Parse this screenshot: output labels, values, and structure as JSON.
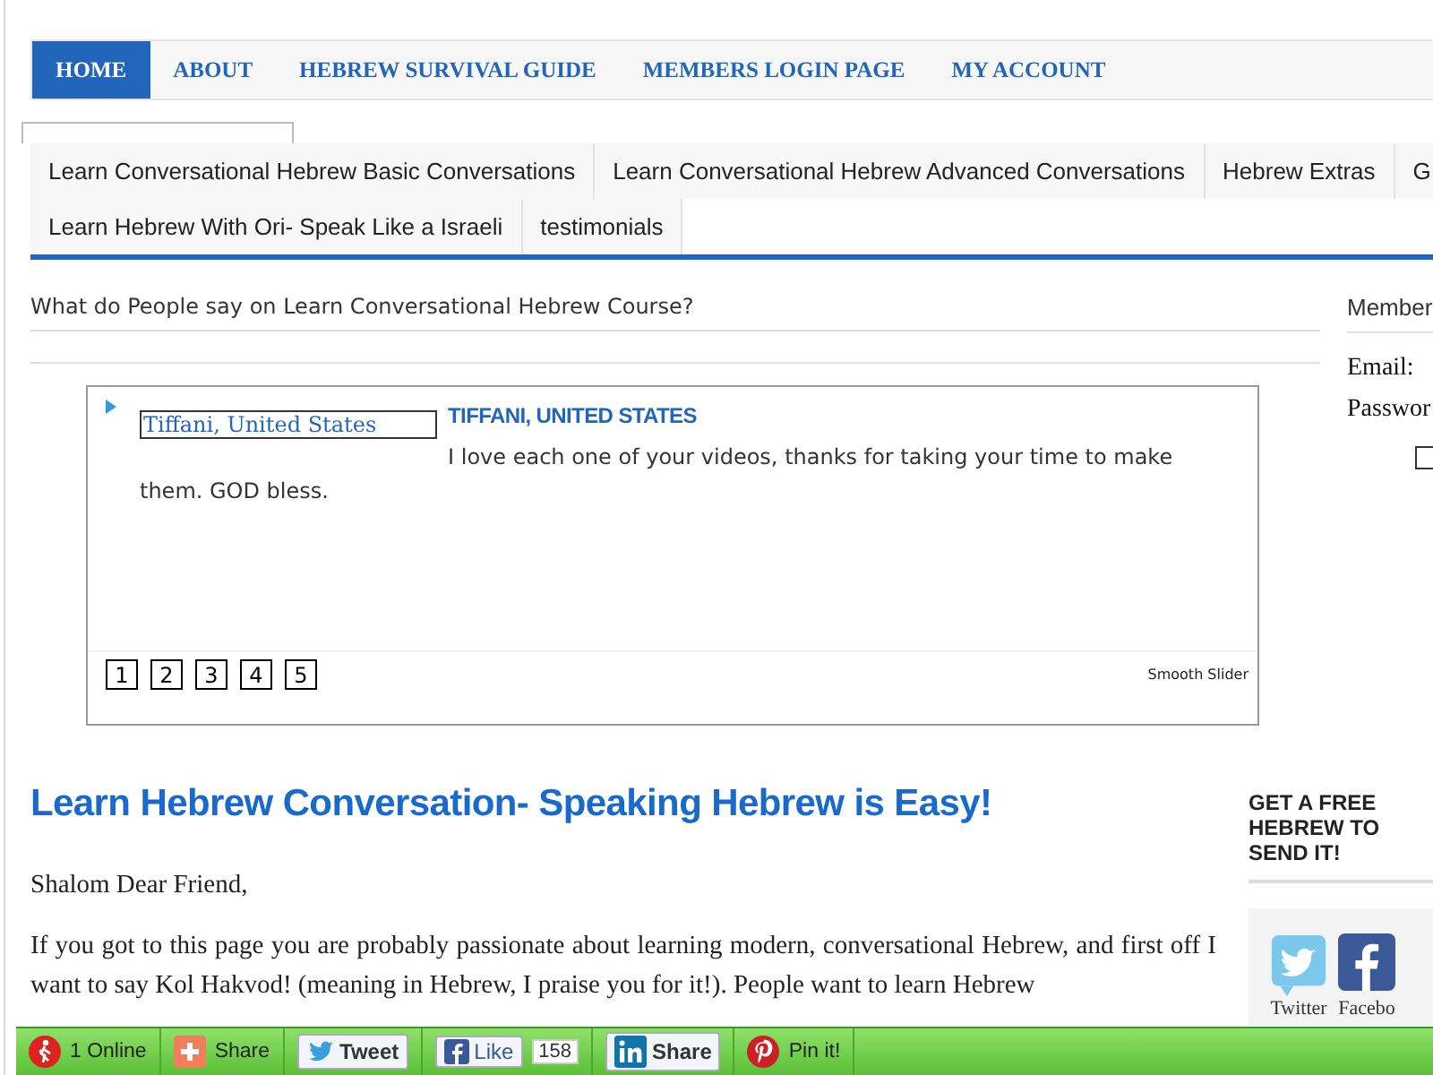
{
  "top_nav": [
    {
      "label": "HOME",
      "selected": true
    },
    {
      "label": "ABOUT",
      "selected": false
    },
    {
      "label": "HEBREW SURVIVAL GUIDE",
      "selected": false
    },
    {
      "label": "MEMBERS LOGIN PAGE",
      "selected": false
    },
    {
      "label": "MY ACCOUNT",
      "selected": false
    }
  ],
  "sub_nav_rows": [
    [
      "Learn Conversational Hebrew Basic Conversations",
      "Learn Conversational Hebrew Advanced Conversations",
      "Hebrew Extras",
      "G"
    ],
    [
      "Learn Hebrew With Ori- Speak Like a Israeli",
      "testimonials"
    ]
  ],
  "testimonials": {
    "title": "What do People say on Learn Conversational Hebrew Course?",
    "slide_link": "Tiffani, United States",
    "slide_title": "TIFFANI, UNITED STATES",
    "slide_text": "I love each one of your videos, thanks for taking your time to make them. GOD bless.",
    "pages": [
      {
        "label": "1",
        "selected": false
      },
      {
        "label": "2",
        "selected": false
      },
      {
        "label": "3",
        "selected": false
      },
      {
        "label": "4",
        "selected": false
      },
      {
        "label": "5",
        "selected": false
      }
    ],
    "credit": "Smooth Slider"
  },
  "login": {
    "title": "Member",
    "email_label": "Email:",
    "password_label": "Passwor",
    "remember": false
  },
  "article": {
    "title": "Learn Hebrew Conversation- Speaking Hebrew is Easy!",
    "greeting": "Shalom Dear Friend,",
    "paragraph": "If you got to this page you are probably passionate about learning modern, conversational Hebrew, and first off I want to say Kol Hakvod! (meaning in Hebrew, I praise you for it!). People want to learn Hebrew"
  },
  "free_offer": {
    "title": "GET A FREE HEBREW TO SEND IT!",
    "social": [
      {
        "kind": "twitter",
        "label": "Twitter"
      },
      {
        "kind": "facebook",
        "label": "Facebo"
      }
    ]
  },
  "share_bar": {
    "online": "1 Online",
    "share": "Share",
    "tweet": "Tweet",
    "like": "Like",
    "like_count": "158",
    "linkedin": "Share",
    "pin": "Pin it!"
  }
}
